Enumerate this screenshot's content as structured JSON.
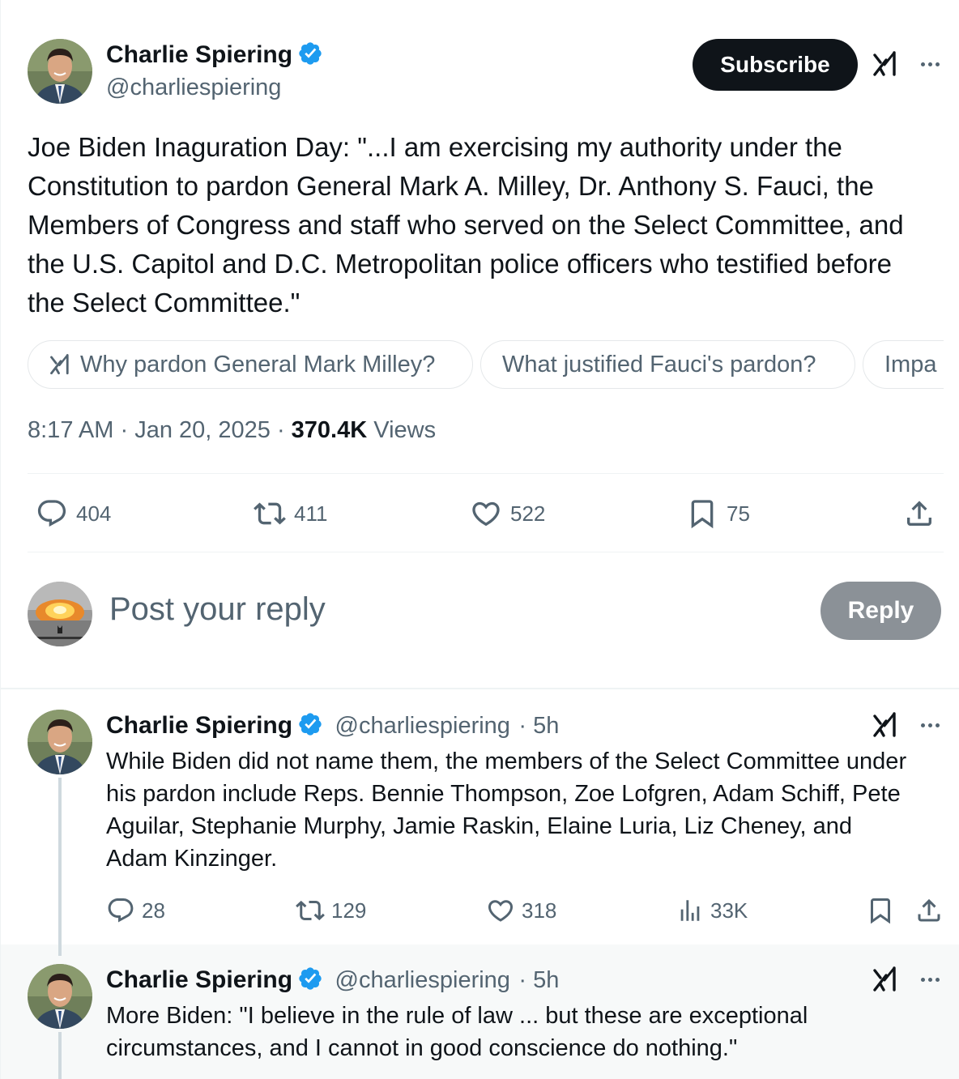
{
  "post": {
    "author_name": "Charlie Spiering",
    "author_handle": "@charliespiering",
    "subscribe_label": "Subscribe",
    "text": "Joe Biden Inaguration Day: \"...I am exercising my authority under the Constitution to pardon General Mark A. Milley, Dr. Anthony S. Fauci, the Members of Congress and staff who served on the Select Committee, and the U.S. Capitol and D.C. Metropolitan police officers who testified before the Select Committee.\"",
    "grok_suggestions": [
      "Why pardon General Mark Milley?",
      "What justified Fauci's pardon?",
      "Impa"
    ],
    "time": "8:17 AM",
    "date": "Jan 20, 2025",
    "views_count": "370.4K",
    "views_label": "Views",
    "replies": "404",
    "reposts": "411",
    "likes": "522",
    "bookmarks": "75"
  },
  "reply_box": {
    "placeholder": "Post your reply",
    "button_label": "Reply"
  },
  "thread": [
    {
      "author_name": "Charlie Spiering",
      "author_handle": "@charliespiering",
      "age": "· 5h",
      "text": "While Biden did not name them, the members of the Select Committee under his pardon include Reps. Bennie Thompson, Zoe Lofgren, Adam Schiff, Pete Aguilar, Stephanie Murphy, Jamie Raskin, Elaine Luria, Liz Cheney, and Adam Kinzinger.",
      "replies": "28",
      "reposts": "129",
      "likes": "318",
      "views": "33K"
    },
    {
      "author_name": "Charlie Spiering",
      "author_handle": "@charliespiering",
      "age": "· 5h",
      "text": "More Biden: \"I believe in the rule of law ... but these are exceptional circumstances, and I cannot in good conscience do nothing.\""
    }
  ],
  "colors": {
    "text": "#0f1419",
    "secondary": "#536471",
    "verified": "#1d9bf0",
    "subscribe_bg": "#0f1419",
    "reply_button_bg": "#8b9197"
  }
}
